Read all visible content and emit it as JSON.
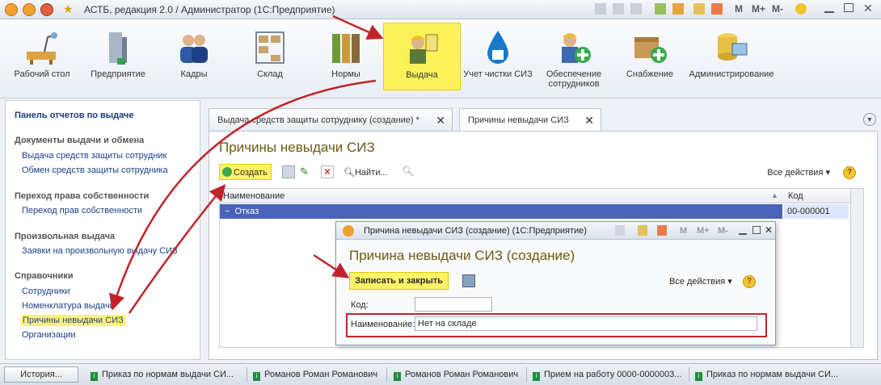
{
  "window": {
    "title": "АСТБ, редакция 2.0 / Администратор (1С:Предприятие)",
    "right_tools": [
      "M",
      "M+",
      "M-"
    ]
  },
  "sections": [
    {
      "label": "Рабочий стол",
      "icon": "desk-icon"
    },
    {
      "label": "Предприятие",
      "icon": "building-icon"
    },
    {
      "label": "Кадры",
      "icon": "people-icon"
    },
    {
      "label": "Склад",
      "icon": "shelves-icon"
    },
    {
      "label": "Нормы",
      "icon": "binders-icon"
    },
    {
      "label": "Выдача",
      "icon": "worker-badge-icon",
      "active": true
    },
    {
      "label": "Учет чистки СИЗ",
      "icon": "water-drop-icon"
    },
    {
      "label": "Обеспечение сотрудников",
      "icon": "worker-plus-icon"
    },
    {
      "label": "Снабжение",
      "icon": "box-plus-icon"
    },
    {
      "label": "Администрирование",
      "icon": "database-icon"
    }
  ],
  "left_panel": {
    "title": "Панель отчетов по выдаче",
    "groups": [
      {
        "title": "Документы выдачи и обмена",
        "items": [
          "Выдача средств защиты сотрудник",
          "Обмен средств защиты сотрудника"
        ]
      },
      {
        "title": "Переход права собственности",
        "items": [
          "Переход прав собственности"
        ]
      },
      {
        "title": "Произвольная выдача",
        "items": [
          "Заявки на произвольную выдачу СИЗ"
        ]
      },
      {
        "title": "Справочники",
        "items": [
          "Сотрудники",
          "Номенклатура выдачи",
          "Причины невыдачи СИЗ",
          "Организации"
        ]
      }
    ],
    "selected": "Причины невыдачи СИЗ"
  },
  "tabs": [
    {
      "label": "Выдача средств защиты сотруднику (создание) *"
    },
    {
      "label": "Причины невыдачи СИЗ",
      "active": true
    }
  ],
  "list": {
    "title": "Причины невыдачи СИЗ",
    "create_label": "Создать",
    "find_label": "Найти...",
    "all_actions": "Все действия",
    "columns": [
      "Наименование",
      "Код"
    ],
    "rows": [
      {
        "name": "Отказ",
        "code": "00-000001"
      }
    ]
  },
  "dialog": {
    "title": "Причина невыдачи СИЗ (создание)  (1С:Предприятие)",
    "heading": "Причина невыдачи СИЗ (создание)",
    "save_label": "Записать и закрыть",
    "all_actions": "Все действия",
    "code_label": "Код:",
    "code_value": "",
    "name_label": "Наименование:",
    "name_value": "Нет на складе",
    "right_tools": [
      "M",
      "M+",
      "M-"
    ]
  },
  "taskbar": {
    "history": "История...",
    "items": [
      "Приказ по нормам выдачи СИ...",
      "Романов Роман Романович",
      "Романов Роман Романович",
      "Прием на работу 0000-0000003...",
      "Приказ по нормам выдачи СИ..."
    ]
  },
  "colors": {
    "highlight": "#fbf25a",
    "annotation": "#c0242a",
    "selection": "#4a62b8",
    "heading": "#6b5a14"
  }
}
